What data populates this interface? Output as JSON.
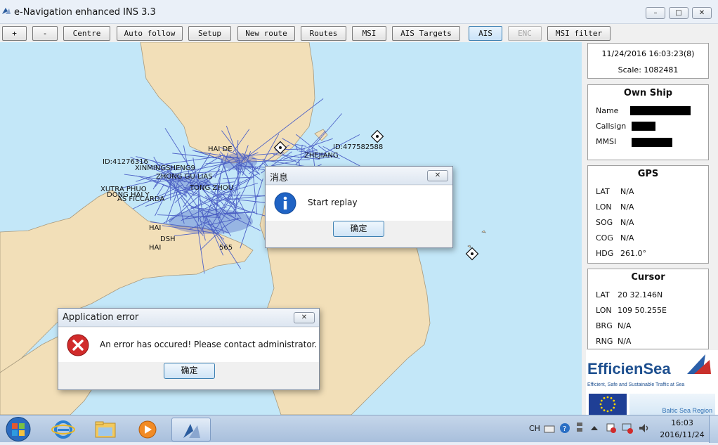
{
  "window": {
    "title": "e-Navigation enhanced INS 3.3",
    "controls": [
      "–",
      "□",
      "✕"
    ]
  },
  "toolbar": {
    "buttons": [
      {
        "label": "+"
      },
      {
        "label": "-"
      },
      {
        "label": "Centre"
      },
      {
        "label": "Auto follow"
      },
      {
        "label": "Setup"
      },
      {
        "label": "New route"
      },
      {
        "label": "Routes"
      },
      {
        "label": "MSI"
      },
      {
        "label": "AIS Targets"
      },
      {
        "label": "AIS",
        "state": "active"
      },
      {
        "label": "ENC",
        "state": "disabled"
      },
      {
        "label": "MSI filter"
      }
    ]
  },
  "status": {
    "datetime": "11/24/2016 16:03:23(8)",
    "scale": "Scale: 1082481"
  },
  "own_ship": {
    "title": "Own Ship",
    "rows": [
      {
        "label": "Name",
        "value": ""
      },
      {
        "label": "Callsign",
        "value": ""
      },
      {
        "label": "MMSI",
        "value": ""
      }
    ]
  },
  "gps": {
    "title": "GPS",
    "rows": [
      {
        "label": "LAT",
        "value": "N/A"
      },
      {
        "label": "LON",
        "value": "N/A"
      },
      {
        "label": "SOG",
        "value": "N/A"
      },
      {
        "label": "COG",
        "value": "N/A"
      },
      {
        "label": "HDG",
        "value": "261.0°"
      }
    ]
  },
  "cursor": {
    "title": "Cursor",
    "rows": [
      {
        "label": "LAT",
        "value": "20 32.146N"
      },
      {
        "label": "LON",
        "value": "109 50.255E"
      },
      {
        "label": "BRG",
        "value": "N/A"
      },
      {
        "label": "RNG",
        "value": "N/A"
      }
    ]
  },
  "logo": {
    "name": "EfficienSea",
    "tagline": "Efficient, Safe and Sustainable Traffic at Sea",
    "region": "Baltic Sea Region"
  },
  "map": {
    "labels": [
      "ID:477582588",
      "ID:41276316",
      "XINMINGSHENG9",
      "ZHONG GU LIAS",
      "XUTRA PHUO",
      "DONG HAI Y",
      "AS FICCARDA",
      "HAI",
      "565",
      "ZHEJIANG",
      "HAI DE",
      "HAI",
      "DSH",
      "TONG ZHOU"
    ]
  },
  "dialog_replay": {
    "title": "消息",
    "message": "Start replay",
    "ok": "确定",
    "close": "✕"
  },
  "dialog_error": {
    "title": "Application error",
    "message": "An error has occured! Please contact administrator.",
    "ok": "确定",
    "close": "✕"
  },
  "taskbar": {
    "lang": "CH",
    "time": "16:03",
    "date": "2016/11/24"
  },
  "colors": {
    "sea": "#c3e7f8",
    "land": "#f2dfb8",
    "tracks": "#4f63c7"
  }
}
